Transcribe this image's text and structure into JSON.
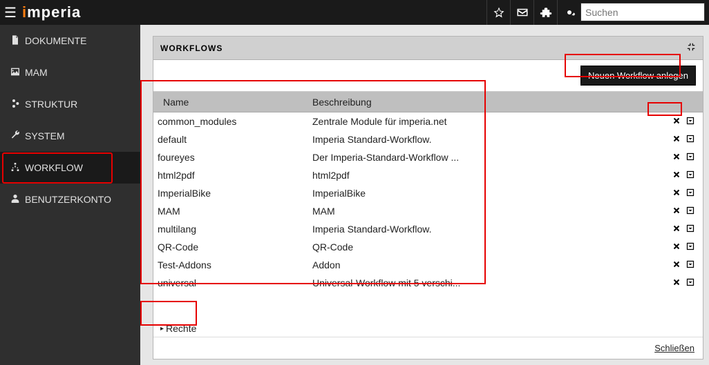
{
  "brand_i": "i",
  "brand_rest": "mperia",
  "search_placeholder": "Suchen",
  "sidebar": {
    "items": [
      {
        "label": "DOKUMENTE"
      },
      {
        "label": "MAM"
      },
      {
        "label": "STRUKTUR"
      },
      {
        "label": "SYSTEM"
      },
      {
        "label": "WORKFLOW"
      },
      {
        "label": "BENUTZERKONTO"
      }
    ]
  },
  "panel": {
    "title": "WORKFLOWS",
    "new_button": "Neuen Workflow anlegen",
    "col_name": "Name",
    "col_desc": "Beschreibung",
    "rechte": "Rechte",
    "close": "Schließen"
  },
  "rows": [
    {
      "name": "common_modules",
      "desc": "Zentrale Module für imperia.net"
    },
    {
      "name": "default",
      "desc": "Imperia Standard-Workflow."
    },
    {
      "name": "foureyes",
      "desc": "Der Imperia-Standard-Workflow ..."
    },
    {
      "name": "html2pdf",
      "desc": "html2pdf"
    },
    {
      "name": "ImperialBike",
      "desc": "ImperialBike"
    },
    {
      "name": "MAM",
      "desc": "MAM"
    },
    {
      "name": "multilang",
      "desc": "Imperia Standard-Workflow."
    },
    {
      "name": "QR-Code",
      "desc": "QR-Code"
    },
    {
      "name": "Test-Addons",
      "desc": "Addon"
    },
    {
      "name": "universal",
      "desc": "Universal-Workflow mit 5 verschi..."
    }
  ]
}
